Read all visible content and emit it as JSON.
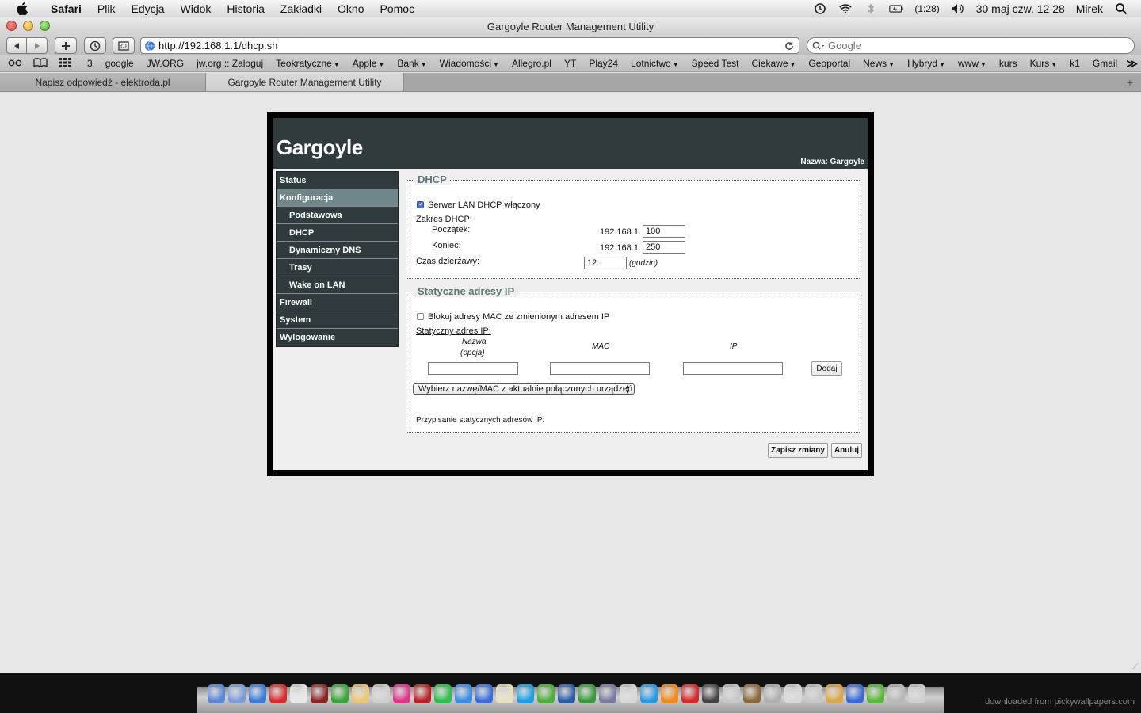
{
  "menubar": {
    "app": "Safari",
    "items": [
      "Plik",
      "Edycja",
      "Widok",
      "Historia",
      "Zakładki",
      "Okno",
      "Pomoc"
    ],
    "battery": "(1:28)",
    "datetime": "30 maj czw.  12 28",
    "user": "Mirek"
  },
  "window": {
    "title": "Gargoyle Router Management Utility"
  },
  "toolbar": {
    "url": "http://192.168.1.1/dhcp.sh",
    "search_placeholder": "Google"
  },
  "bookmarks": {
    "items": [
      {
        "label": "3",
        "dropdown": false
      },
      {
        "label": "google",
        "dropdown": false
      },
      {
        "label": "JW.ORG",
        "dropdown": false
      },
      {
        "label": "jw.org :: Zaloguj",
        "dropdown": false
      },
      {
        "label": "Teokratyczne",
        "dropdown": true
      },
      {
        "label": "Apple",
        "dropdown": true
      },
      {
        "label": "Bank",
        "dropdown": true
      },
      {
        "label": "Wiadomości",
        "dropdown": true
      },
      {
        "label": "Allegro.pl",
        "dropdown": false
      },
      {
        "label": "YT",
        "dropdown": false
      },
      {
        "label": "Play24",
        "dropdown": false
      },
      {
        "label": "Lotnictwo",
        "dropdown": true
      },
      {
        "label": "Speed Test",
        "dropdown": false
      },
      {
        "label": "Ciekawe",
        "dropdown": true
      },
      {
        "label": "Geoportal",
        "dropdown": false
      },
      {
        "label": "News",
        "dropdown": true
      },
      {
        "label": "Hybryd",
        "dropdown": true
      },
      {
        "label": "www",
        "dropdown": true
      },
      {
        "label": "kurs",
        "dropdown": false
      },
      {
        "label": "Kurs",
        "dropdown": true
      },
      {
        "label": "k1",
        "dropdown": false
      },
      {
        "label": "Gmail",
        "dropdown": false
      }
    ]
  },
  "tabs": [
    {
      "label": "Napisz odpowiedź - elektroda.pl",
      "active": false
    },
    {
      "label": "Gargoyle Router Management Utility",
      "active": true
    }
  ],
  "router": {
    "brand": "Gargoyle",
    "hostname": "Nazwa: Gargoyle",
    "nav": [
      {
        "label": "Status",
        "level": 0,
        "active": false
      },
      {
        "label": "Konfiguracja",
        "level": 0,
        "active": true
      },
      {
        "label": "Podstawowa",
        "level": 1,
        "active": false
      },
      {
        "label": "DHCP",
        "level": 1,
        "active": false,
        "current": true
      },
      {
        "label": "Dynamiczny DNS",
        "level": 1,
        "active": false
      },
      {
        "label": "Trasy",
        "level": 1,
        "active": false
      },
      {
        "label": "Wake on LAN",
        "level": 1,
        "active": false
      },
      {
        "label": "Firewall",
        "level": 0,
        "active": false
      },
      {
        "label": "System",
        "level": 0,
        "active": false
      },
      {
        "label": "Wylogowanie",
        "level": 0,
        "active": false
      }
    ],
    "dhcp": {
      "legend": "DHCP",
      "enable_label": "Serwer LAN DHCP włączony",
      "enabled": true,
      "range_label": "Zakres DHCP:",
      "start_label": "Początek:",
      "end_label": "Koniec:",
      "prefix": "192.168.1.",
      "start_value": "100",
      "end_value": "250",
      "lease_label": "Czas dzierżawy:",
      "lease_value": "12",
      "lease_unit": "(godzin)"
    },
    "static": {
      "legend": "Statyczne adresy IP",
      "block_label": "Blokuj adresy MAC ze zmienionym adresem IP",
      "block_enabled": false,
      "section_label": "Statyczny adres IP:",
      "col_name": "Nazwa",
      "col_name_sub": "(opcja)",
      "col_mac": "MAC",
      "col_ip": "IP",
      "add_button": "Dodaj",
      "select_label": "Wybierz nazwę/MAC z aktualnie połączonych urządzeń",
      "assign_label": "Przypisanie statycznych adresów IP:"
    },
    "save_button": "Zapisz zmiany",
    "cancel_button": "Anuluj"
  },
  "dock": {
    "credit": "downloaded from pickywallpapers.com",
    "icon_colors": [
      "#5a86d6",
      "#7a9fd8",
      "#3a7bd5",
      "#d92b2b",
      "#e8e8e8",
      "#8b2323",
      "#3aa63a",
      "#e8c77a",
      "#d0d0d0",
      "#e0338a",
      "#b82222",
      "#2fbf4f",
      "#3a8de0",
      "#3a6fd8",
      "#e8e0c0",
      "#1aa0e0",
      "#4fae3a",
      "#2a5ca8",
      "#3a9a3a",
      "#7a7aa0",
      "#d8d8d8",
      "#2a9ae0",
      "#f08a1a",
      "#d42a2a",
      "#444444",
      "#c8c8c8",
      "#8a6a3a",
      "#b0b0b0",
      "#d8d8d8",
      "#c8c8c8",
      "#d8a84a",
      "#3a6ad8",
      "#5ab83a",
      "#b8b8b8",
      "#d0d0d0"
    ]
  }
}
